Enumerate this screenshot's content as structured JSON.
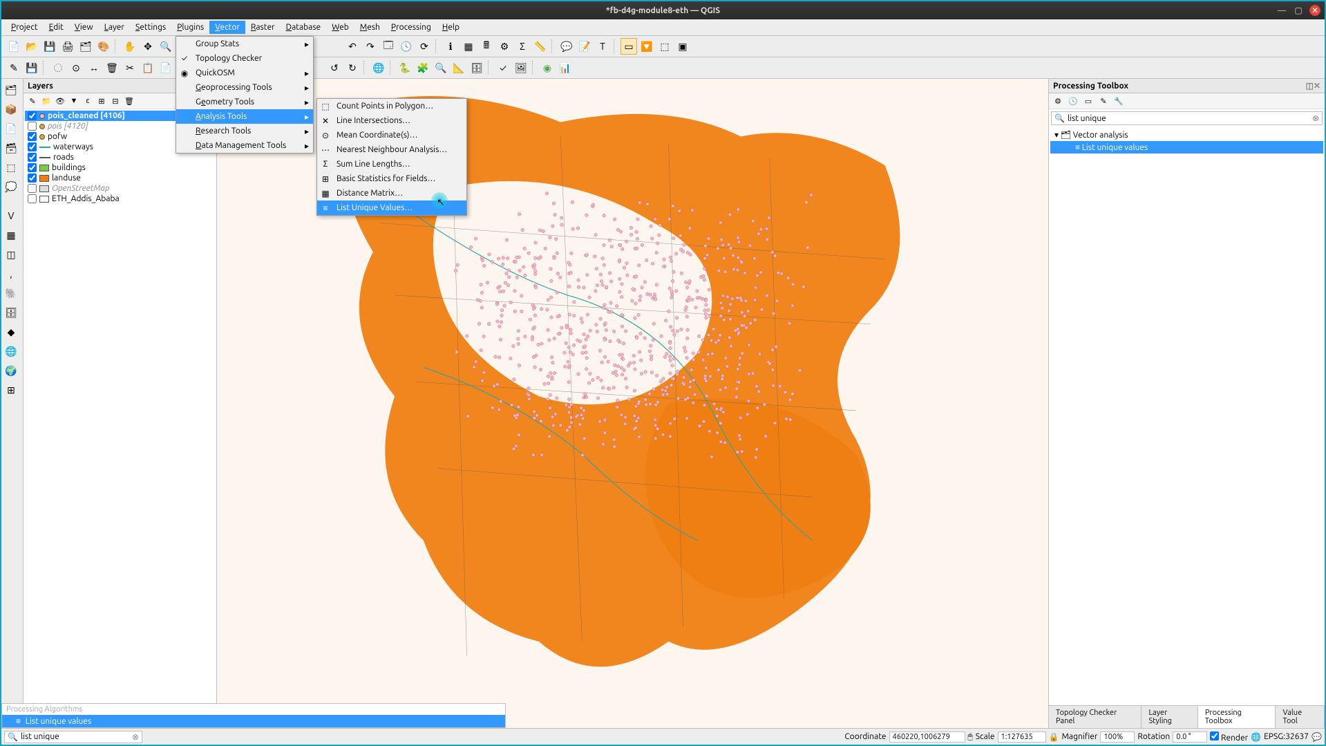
{
  "title": "*fb-d4g-module8-eth — QGIS",
  "menubar": [
    "Project",
    "Edit",
    "View",
    "Layer",
    "Settings",
    "Plugins",
    "Vector",
    "Raster",
    "Database",
    "Web",
    "Mesh",
    "Processing",
    "Help"
  ],
  "active_menu_index": 6,
  "vector_menu": {
    "items": [
      {
        "label": "Group Stats",
        "sub": true
      },
      {
        "label": "Topology Checker",
        "icon": "✓"
      },
      {
        "label": "QuickOSM",
        "icon": "◉",
        "sub": true
      },
      {
        "label": "Geoprocessing Tools",
        "sub": true,
        "underline": "G"
      },
      {
        "label": "Geometry Tools",
        "sub": true,
        "underline": "e"
      },
      {
        "label": "Analysis Tools",
        "sub": true,
        "underline": "A",
        "highlighted": true
      },
      {
        "label": "Research Tools",
        "sub": true,
        "underline": "R"
      },
      {
        "label": "Data Management Tools",
        "sub": true,
        "underline": "D"
      }
    ]
  },
  "analysis_submenu": {
    "items": [
      {
        "label": "Count Points in Polygon…",
        "icon": "⬚"
      },
      {
        "label": "Line Intersections…",
        "icon": "✕"
      },
      {
        "label": "Mean Coordinate(s)…",
        "icon": "⊙"
      },
      {
        "label": "Nearest Neighbour Analysis…",
        "icon": "⋯"
      },
      {
        "label": "Sum Line Lengths…",
        "icon": "Σ"
      },
      {
        "label": "Basic Statistics for Fields…",
        "icon": "⊞"
      },
      {
        "label": "Distance Matrix…",
        "icon": "▦"
      },
      {
        "label": "List Unique Values…",
        "icon": "≡",
        "highlighted": true
      }
    ]
  },
  "layers_panel": {
    "title": "Layers",
    "items": [
      {
        "checked": true,
        "swatch": "point",
        "color": "#f5b5c8",
        "name": "pois_cleaned [4106]",
        "selected": true
      },
      {
        "checked": false,
        "swatch": "point",
        "color": "#d9a536",
        "name": "pois [4120]",
        "italic": true
      },
      {
        "checked": true,
        "swatch": "point",
        "color": "#d9a536",
        "name": "pofw"
      },
      {
        "checked": true,
        "swatch": "line",
        "color": "#2aa3a3",
        "name": "waterways"
      },
      {
        "checked": true,
        "swatch": "line",
        "color": "#555",
        "name": "roads"
      },
      {
        "checked": true,
        "swatch": "rect",
        "color": "#7ac943",
        "name": "buildings"
      },
      {
        "checked": true,
        "swatch": "rect",
        "color": "#f07f13",
        "name": "landuse"
      },
      {
        "checked": false,
        "swatch": "rect",
        "color": "#ddd",
        "name": "OpenStreetMap",
        "italic": true
      },
      {
        "checked": false,
        "swatch": "rect",
        "color": "#fff",
        "name": "ETH_Addis_Ababa"
      }
    ]
  },
  "toolbox": {
    "title": "Processing Toolbox",
    "search": "list unique",
    "groups": [
      {
        "label": "Vector analysis",
        "children": [
          {
            "label": "List unique values",
            "selected": true
          }
        ]
      }
    ]
  },
  "right_tabs": [
    "Topology Checker Panel",
    "Layer Styling",
    "Processing Toolbox",
    "Value Tool"
  ],
  "right_tab_active": 2,
  "locator": {
    "value": "list unique",
    "popup_header": "Processing Algorithms",
    "popup_result": "List unique values"
  },
  "status": {
    "coord_label": "Coordinate",
    "coord": "460220,1006279",
    "scale_label": "Scale",
    "scale": "1:127635",
    "magnifier_label": "Magnifier",
    "magnifier": "100%",
    "rotation_label": "Rotation",
    "rotation": "0.0 °",
    "render": "Render",
    "crs": "EPSG:32637"
  },
  "colors": {
    "orange": "#f07f13",
    "pink": "#f5b5c8",
    "teal": "#2aa3a3",
    "cream": "#fdf6ef"
  }
}
